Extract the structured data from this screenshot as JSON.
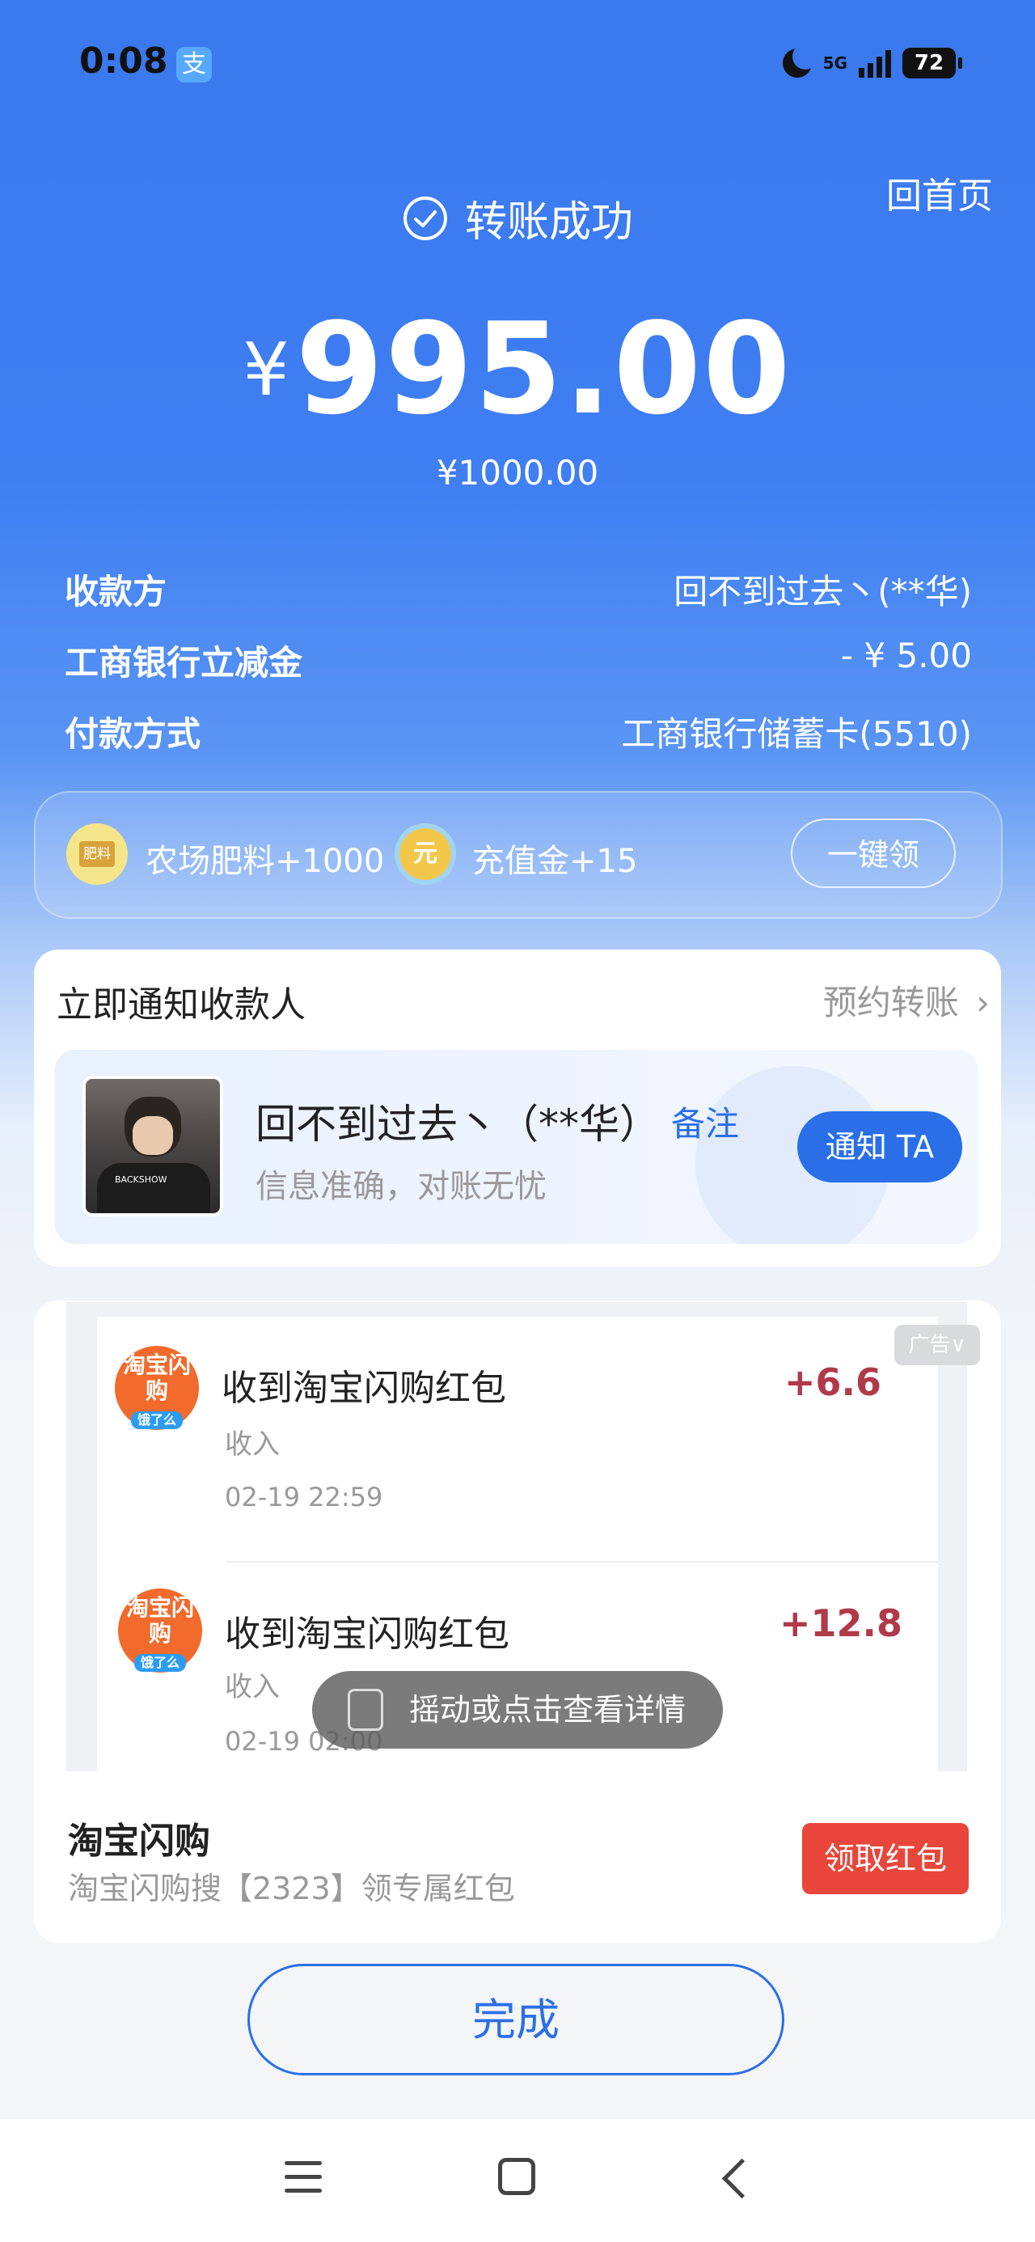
{
  "status_bar": {
    "time": "0:08",
    "app_icon": "支",
    "network": "5G",
    "battery": "72"
  },
  "header": {
    "home_link": "回首页",
    "success_text": "转账成功",
    "currency": "¥",
    "amount": "995.00",
    "original_amount": "¥1000.00"
  },
  "details": [
    {
      "label": "收款方",
      "value": "回不到过去丶(**华)"
    },
    {
      "label": "工商银行立减金",
      "value": "- ¥ 5.00"
    },
    {
      "label": "付款方式",
      "value": "工商银行储蓄卡(5510)"
    }
  ],
  "rewards": {
    "fertilizer": "农场肥料+1000",
    "recharge": "充值金+15",
    "claim_button": "一键领"
  },
  "notify": {
    "title": "立即通知收款人",
    "schedule_link": "预约转账",
    "recipient_name": "回不到过去丶（**华）",
    "note_link": "备注",
    "subtitle": "信息准确，对账无忧",
    "notify_button": "通知 TA",
    "avatar_shirt_text": "BACKSHOW"
  },
  "ad": {
    "tag": "广告",
    "transactions": [
      {
        "icon_text": "淘宝闪购",
        "title": "收到淘宝闪购红包",
        "type": "收入",
        "time": "02-19 22:59",
        "amount": "+6.6"
      },
      {
        "icon_text": "淘宝闪购",
        "title": "收到淘宝闪购红包",
        "type": "收入",
        "time": "02-19 02:00",
        "amount": "+12.8"
      }
    ],
    "icon_badge": "饿了么",
    "toast": "摇动或点击查看详情",
    "brand": "淘宝闪购",
    "brand_sub": "淘宝闪购搜【2323】领专属红包",
    "cta": "领取红包"
  },
  "done_button": "完成"
}
